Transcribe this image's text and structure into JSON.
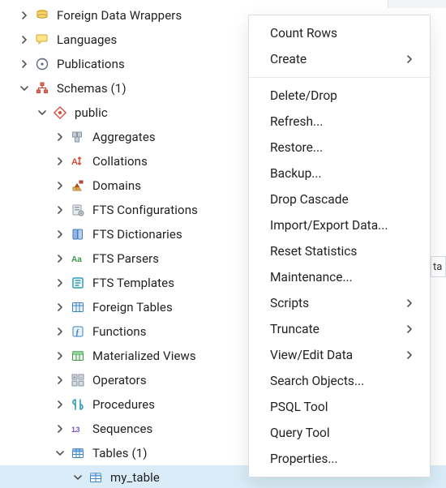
{
  "tree": {
    "items": [
      {
        "depth": 0,
        "expand": "right",
        "icon": "wrappers",
        "label": "Foreign Data Wrappers"
      },
      {
        "depth": 0,
        "expand": "right",
        "icon": "languages",
        "label": "Languages"
      },
      {
        "depth": 0,
        "expand": "right",
        "icon": "publications",
        "label": "Publications"
      },
      {
        "depth": 0,
        "expand": "down",
        "icon": "schemas",
        "label": "Schemas (1)"
      },
      {
        "depth": 1,
        "expand": "down",
        "icon": "public",
        "label": "public"
      },
      {
        "depth": 2,
        "expand": "right",
        "icon": "aggregates",
        "label": "Aggregates"
      },
      {
        "depth": 2,
        "expand": "right",
        "icon": "collations",
        "label": "Collations"
      },
      {
        "depth": 2,
        "expand": "right",
        "icon": "domains",
        "label": "Domains"
      },
      {
        "depth": 2,
        "expand": "right",
        "icon": "ftsconf",
        "label": "FTS Configurations"
      },
      {
        "depth": 2,
        "expand": "right",
        "icon": "ftsdict",
        "label": "FTS Dictionaries"
      },
      {
        "depth": 2,
        "expand": "right",
        "icon": "ftspars",
        "label": "FTS Parsers"
      },
      {
        "depth": 2,
        "expand": "right",
        "icon": "ftstmpl",
        "label": "FTS Templates"
      },
      {
        "depth": 2,
        "expand": "right",
        "icon": "foreigntables",
        "label": "Foreign Tables"
      },
      {
        "depth": 2,
        "expand": "right",
        "icon": "functions",
        "label": "Functions"
      },
      {
        "depth": 2,
        "expand": "right",
        "icon": "matviews",
        "label": "Materialized Views"
      },
      {
        "depth": 2,
        "expand": "right",
        "icon": "operators",
        "label": "Operators"
      },
      {
        "depth": 2,
        "expand": "right",
        "icon": "procedures",
        "label": "Procedures"
      },
      {
        "depth": 2,
        "expand": "right",
        "icon": "sequences",
        "label": "Sequences"
      },
      {
        "depth": 2,
        "expand": "down",
        "icon": "tables",
        "label": "Tables (1)"
      },
      {
        "depth": 3,
        "expand": "down",
        "icon": "table",
        "label": "my_table",
        "selected": true
      }
    ]
  },
  "context_menu": {
    "items": [
      {
        "label": "Count Rows"
      },
      {
        "label": "Create",
        "submenu": true
      },
      {
        "sep": true
      },
      {
        "label": "Delete/Drop"
      },
      {
        "label": "Refresh..."
      },
      {
        "label": "Restore..."
      },
      {
        "label": "Backup..."
      },
      {
        "label": "Drop Cascade"
      },
      {
        "label": "Import/Export Data..."
      },
      {
        "label": "Reset Statistics"
      },
      {
        "label": "Maintenance..."
      },
      {
        "label": "Scripts",
        "submenu": true
      },
      {
        "label": "Truncate",
        "submenu": true
      },
      {
        "label": "View/Edit Data",
        "submenu": true
      },
      {
        "label": "Search Objects..."
      },
      {
        "label": "PSQL Tool"
      },
      {
        "label": "Query Tool"
      },
      {
        "label": "Properties..."
      }
    ]
  },
  "gutter": {
    "partial_tab_label": "ta"
  }
}
